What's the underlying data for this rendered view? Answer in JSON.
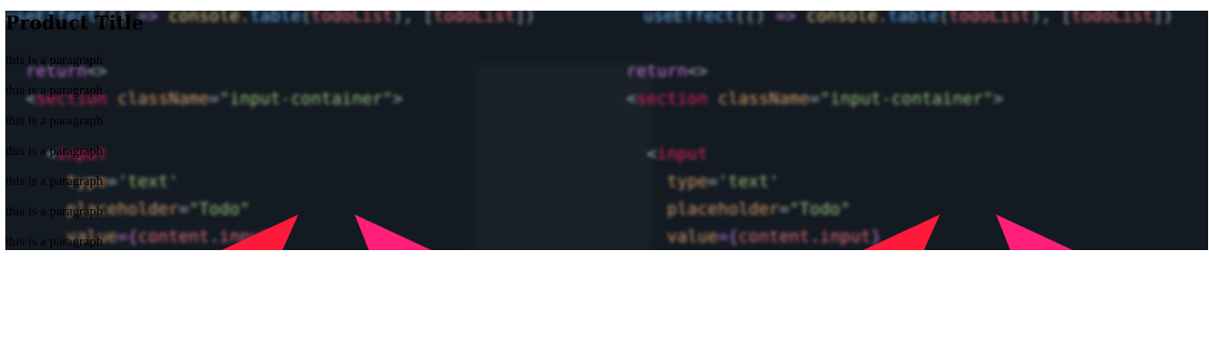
{
  "page": {
    "title": "Product Title",
    "paragraphs": [
      "this is a paragraph",
      "this is a paragraph",
      "this is a paragraph",
      "this is a paragraph",
      "this is a paragraph",
      "this is a paragraph",
      "this is a paragraph"
    ]
  },
  "banner_code": {
    "lines": [
      {
        "parts": [
          {
            "t": "useEffect",
            "c": "prop"
          },
          {
            "t": "(() ",
            "c": "punc"
          },
          {
            "t": "=>",
            "c": "kw"
          },
          {
            "t": " console",
            "c": "fn"
          },
          {
            "t": ".",
            "c": "punc"
          },
          {
            "t": "table",
            "c": "prop"
          },
          {
            "t": "(",
            "c": "punc"
          },
          {
            "t": "todoList",
            "c": "var"
          },
          {
            "t": "), [",
            "c": "punc"
          },
          {
            "t": "todoList",
            "c": "var"
          },
          {
            "t": "])",
            "c": "punc"
          }
        ]
      },
      {
        "parts": [
          {
            "t": "  return",
            "c": "kw"
          },
          {
            "t": "<>",
            "c": "punc"
          }
        ]
      },
      {
        "parts": [
          {
            "t": "  <",
            "c": "punc"
          },
          {
            "t": "section",
            "c": "tag"
          },
          {
            "t": " className",
            "c": "attr"
          },
          {
            "t": "=",
            "c": "punc"
          },
          {
            "t": "\"input-container\"",
            "c": "str"
          },
          {
            "t": ">",
            "c": "punc"
          }
        ]
      },
      {
        "parts": [
          {
            "t": "    <",
            "c": "punc"
          },
          {
            "t": "input",
            "c": "tag"
          }
        ]
      },
      {
        "parts": [
          {
            "t": "      type",
            "c": "attr"
          },
          {
            "t": "=",
            "c": "punc"
          },
          {
            "t": "'text'",
            "c": "str"
          }
        ]
      },
      {
        "parts": [
          {
            "t": "      placeholder",
            "c": "attr"
          },
          {
            "t": "=",
            "c": "punc"
          },
          {
            "t": "\"Todo\"",
            "c": "str"
          }
        ]
      },
      {
        "parts": [
          {
            "t": "      value",
            "c": "attr"
          },
          {
            "t": "={",
            "c": "kw"
          },
          {
            "t": "content",
            "c": "var"
          },
          {
            "t": ".",
            "c": "punc"
          },
          {
            "t": "input",
            "c": "var"
          },
          {
            "t": "}",
            "c": "kw"
          }
        ]
      }
    ]
  },
  "colors": {
    "banner_bg": "#141a22",
    "arrow_red": "#ff1a3a",
    "arrow_pink": "#ff1f7a"
  }
}
